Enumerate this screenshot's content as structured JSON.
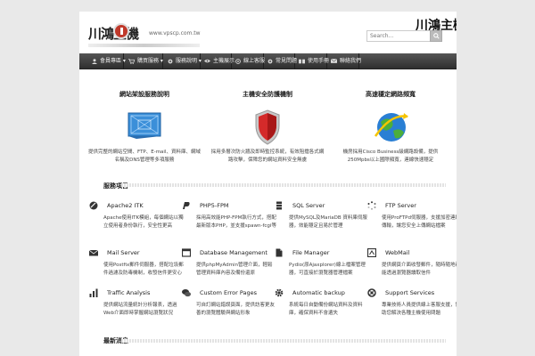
{
  "header": {
    "logo_text": "川鴻主機",
    "logo_url": "www.vpscp.com.tw",
    "site_title": "川鴻主機",
    "search_placeholder": "Search..."
  },
  "nav": {
    "items": [
      {
        "label": "會員專區",
        "icon": "user-icon",
        "dropdown": true
      },
      {
        "label": "購買服務",
        "icon": "cart-icon",
        "dropdown": true
      },
      {
        "label": "服務說明",
        "icon": "gear-icon",
        "dropdown": true
      },
      {
        "label": "主機展示",
        "icon": "eye-icon",
        "dropdown": false
      },
      {
        "label": "線上客服",
        "icon": "support-icon",
        "dropdown": false
      },
      {
        "label": "常見問題",
        "icon": "gear-icon",
        "dropdown": false
      },
      {
        "label": "使用手冊",
        "icon": "book-icon",
        "dropdown": false
      },
      {
        "label": "聯絡我們",
        "icon": "mail-icon",
        "dropdown": false
      }
    ]
  },
  "features": [
    {
      "title": "網站架設服務說明",
      "icon": "blueprint-icon",
      "desc": "提供完整的網站空間、FTP、E-mail、資料庫、網域名稱及DNS管理等多項服務"
    },
    {
      "title": "主機安全防護機制",
      "icon": "shield-icon",
      "desc": "採用多層次防火牆及即時監控系統，有效阻擋各式網路攻擊，保障您的網站資料安全無虞"
    },
    {
      "title": "高速穩定網路頻寬",
      "icon": "globe-icon",
      "desc": "機房採用Cisco Business級網路設備，提供250Mpbs以上國際頻寬，連線快速穩定"
    }
  ],
  "sections": {
    "services_heading": "服務項目",
    "second_heading": "最新消息"
  },
  "services": [
    {
      "title": "Apache2 ITK",
      "icon": "apache-icon",
      "desc": "Apache使用ITK模組，每個網站以獨立使用者身份執行，安全性更高"
    },
    {
      "title": "PHP5-FPM",
      "icon": "php-icon",
      "desc": "採用高效能PHP-FPM執行方式，搭配最新版本PHP，並支援spawn-fcgi等多種模式"
    },
    {
      "title": "SQL Server",
      "icon": "database-icon",
      "desc": "提供MySQL及MariaDB 資料庫伺服器，效能穩定且易於管理"
    },
    {
      "title": "FTP Server",
      "icon": "ftp-icon",
      "desc": "使用ProFTPd伺服器，支援加密連線傳輸，讓您安全上傳網站檔案"
    },
    {
      "title": "Mail Server",
      "icon": "mail-icon",
      "desc": "使用Postfix郵件伺服器，搭配垃圾郵件過濾及防毒機制，收發信件更安心"
    },
    {
      "title": "Database Management",
      "icon": "window-icon",
      "desc": "提供phpMyAdmin管理介面，輕鬆管理資料庫內容及備份還原"
    },
    {
      "title": "File Manager",
      "icon": "file-icon",
      "desc": "Pydio(原Ajaxplorer)線上檔案管理器，可直接於瀏覽器管理檔案"
    },
    {
      "title": "WebMail",
      "icon": "webmail-icon",
      "desc": "提供網頁介面收發郵件，隨時隨地都能透過瀏覽器讀取信件"
    },
    {
      "title": "Traffic Analysis",
      "icon": "chart-icon",
      "desc": "提供網站流量統計分析報表，透過Web介面即時掌握網站瀏覽狀況"
    },
    {
      "title": "Custom Error Pages",
      "icon": "chat-icon",
      "desc": "可自訂網站錯誤頁面，提供訪客更友善的瀏覽體驗與網站形象"
    },
    {
      "title": "Automatic backup",
      "icon": "gear-icon",
      "desc": "系統每日自動備份網站資料及資料庫，確保資料不會遺失"
    },
    {
      "title": "Support Services",
      "icon": "support-icon",
      "desc": "專業技術人員提供線上客服支援，協助您解決各種主機使用問題"
    }
  ],
  "colors": {
    "nav_bg": "#3a3a3a",
    "page_bg": "#ffffff",
    "outer_bg": "#e9e9e9",
    "logo_red": "#c0392b"
  }
}
